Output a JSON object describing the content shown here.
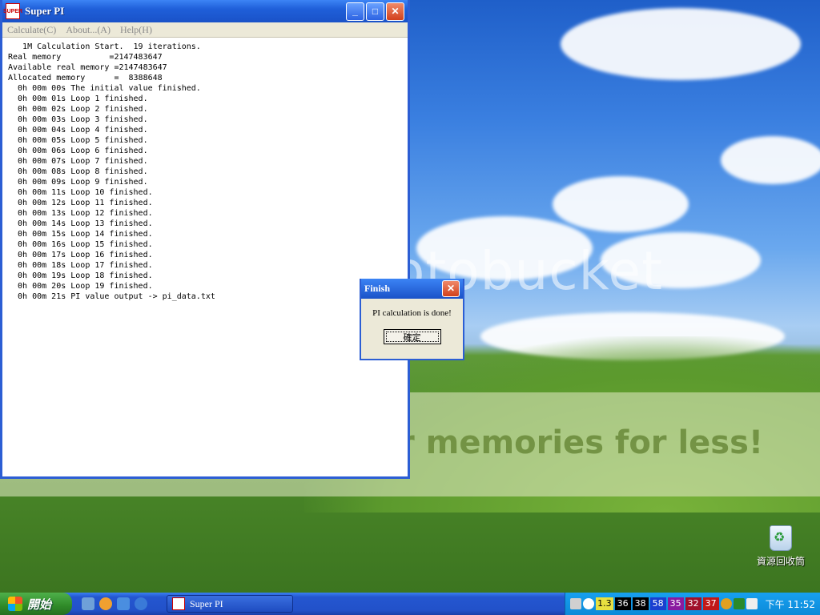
{
  "window": {
    "title": "Super PI",
    "icon_text": "SUPER",
    "menu": [
      "Calculate(C)",
      "About...(A)",
      "Help(H)"
    ],
    "console_lines": [
      "   1M Calculation Start.  19 iterations.",
      "Real memory          =2147483647",
      "Available real memory =2147483647",
      "Allocated memory      =  8388648",
      "  0h 00m 00s The initial value finished.",
      "  0h 00m 01s Loop 1 finished.",
      "  0h 00m 02s Loop 2 finished.",
      "  0h 00m 03s Loop 3 finished.",
      "  0h 00m 04s Loop 4 finished.",
      "  0h 00m 05s Loop 5 finished.",
      "  0h 00m 06s Loop 6 finished.",
      "  0h 00m 07s Loop 7 finished.",
      "  0h 00m 08s Loop 8 finished.",
      "  0h 00m 09s Loop 9 finished.",
      "  0h 00m 11s Loop 10 finished.",
      "  0h 00m 12s Loop 11 finished.",
      "  0h 00m 13s Loop 12 finished.",
      "  0h 00m 14s Loop 13 finished.",
      "  0h 00m 15s Loop 14 finished.",
      "  0h 00m 16s Loop 15 finished.",
      "  0h 00m 17s Loop 16 finished.",
      "  0h 00m 18s Loop 17 finished.",
      "  0h 00m 19s Loop 18 finished.",
      "  0h 00m 20s Loop 19 finished.",
      "  0h 00m 21s PI value output -> pi_data.txt"
    ]
  },
  "dialog": {
    "title": "Finish",
    "message": "PI calculation is done!",
    "ok_label": "確定"
  },
  "desktop": {
    "watermark": "otobucket",
    "banner": "r memories for less!",
    "recycle_bin_label": "資源回收筒"
  },
  "taskbar": {
    "start_label": "開始",
    "task_label": "Super PI",
    "tray_values": [
      "1.3",
      "36",
      "38",
      "58",
      "35",
      "32",
      "37"
    ],
    "clock": "下午 11:52"
  }
}
